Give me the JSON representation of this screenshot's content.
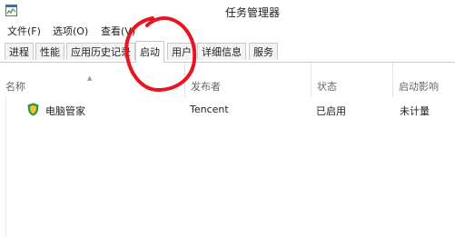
{
  "window": {
    "title": "任务管理器"
  },
  "menu": [
    {
      "label": "文件(F)"
    },
    {
      "label": "选项(O)"
    },
    {
      "label": "查看(V)"
    }
  ],
  "tabs": [
    {
      "label": "进程"
    },
    {
      "label": "性能"
    },
    {
      "label": "应用历史记录"
    },
    {
      "label": "启动"
    },
    {
      "label": "用户"
    },
    {
      "label": "详细信息"
    },
    {
      "label": "服务"
    }
  ],
  "active_tab": "启动",
  "columns": [
    {
      "label": "名称"
    },
    {
      "label": "发布者"
    },
    {
      "label": "状态"
    },
    {
      "label": "启动影响"
    }
  ],
  "rows": [
    {
      "name": "电脑管家",
      "publisher": "Tencent",
      "status": "已启用",
      "impact": "未计量"
    }
  ],
  "colors": {
    "annotation": "#e8151e",
    "shield_green": "#2e9a3c",
    "shield_yellow": "#f2c230"
  },
  "icons": {
    "app": "task-manager-icon",
    "row": "tencent-shield-icon",
    "sort": "sort-up-arrow"
  }
}
